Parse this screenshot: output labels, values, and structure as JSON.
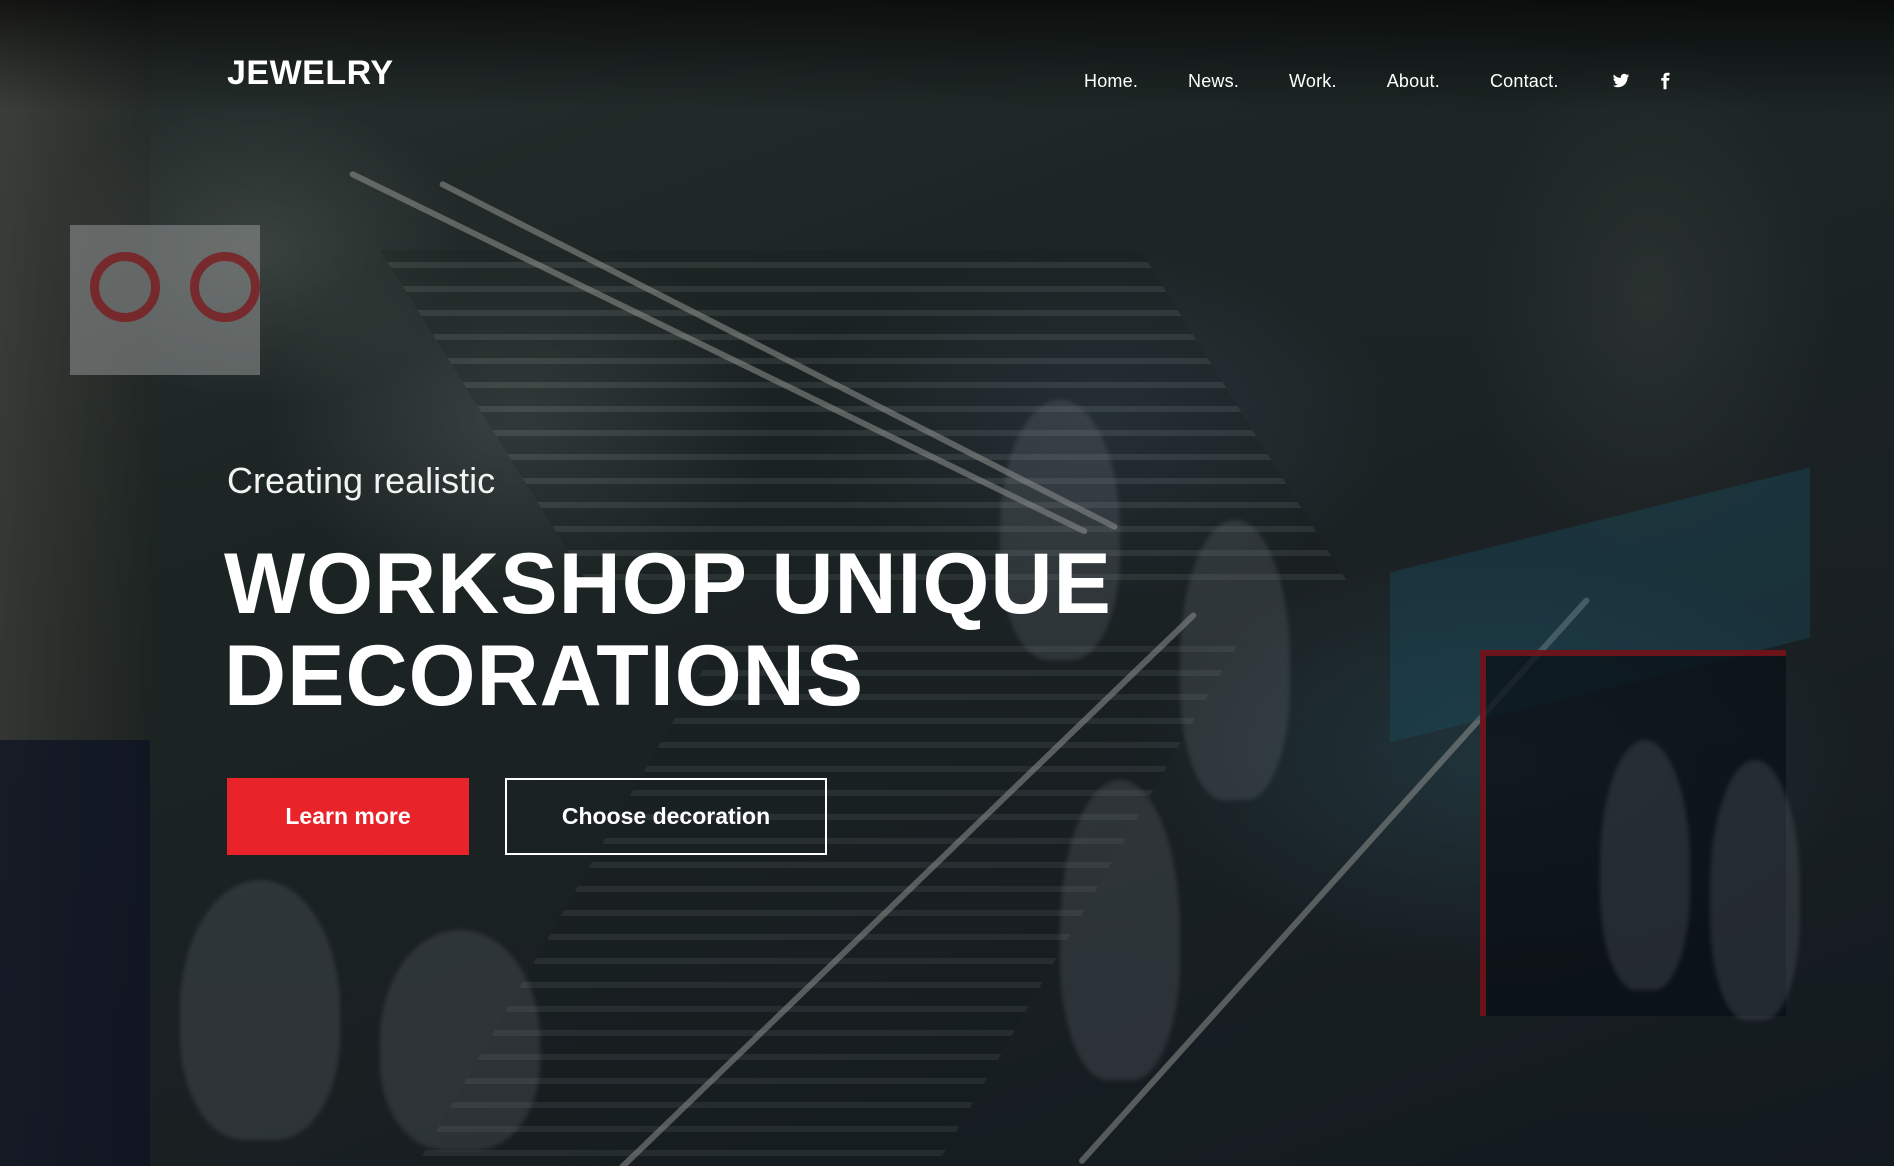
{
  "header": {
    "logo": "JEWELRY",
    "nav": [
      "Home.",
      "News.",
      "Work.",
      "About.",
      "Contact."
    ],
    "social_icons": [
      "twitter-icon",
      "facebook-icon"
    ]
  },
  "hero": {
    "subtitle": "Creating realistic",
    "title_line1": "WORKSHOP UNIQUE",
    "title_line2": "DECORATIONS",
    "primary_button": "Learn more",
    "secondary_button": "Choose decoration"
  },
  "colors": {
    "accent": "#e8232a",
    "text": "#ffffff",
    "overlay": "#000000"
  }
}
